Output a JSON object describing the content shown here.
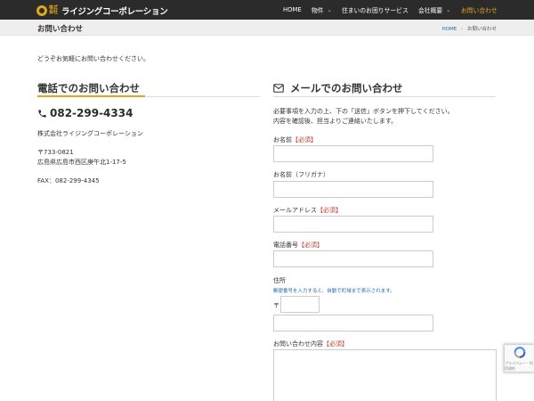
{
  "header": {
    "logo_small": "株式会社",
    "logo_text": "ライジングコーポレーション",
    "nav": [
      {
        "label": "HOME"
      },
      {
        "label": "物件"
      },
      {
        "label": "住まいのお困りサービス"
      },
      {
        "label": "会社概要"
      },
      {
        "label": "お問い合わせ"
      }
    ]
  },
  "titlebar": {
    "title": "お問い合わせ",
    "breadcrumb_home": "HOME",
    "breadcrumb_sep": "›",
    "breadcrumb_current": "お問い合わせ"
  },
  "intro": "どうぞお気軽にお問い合わせください。",
  "phone_section": {
    "heading": "電話でのお問い合わせ",
    "phone": "082-299-4334",
    "company": "株式会社ライジングコーポレーション",
    "postal": "〒733-0821",
    "address": "広島県広島市西区庚午北1-17-5",
    "fax": "FAX：082-299-4345"
  },
  "mail_section": {
    "heading": "メールでのお問い合わせ",
    "instruction1": "必要事項を入力の上、下の「送信」ボタンを押下してください。",
    "instruction2": "内容を確認後、担当よりご連絡いたします。",
    "required_mark": "【必須】",
    "label_name": "お名前",
    "label_kana": "お名前（フリガナ）",
    "label_email": "メールアドレス",
    "label_tel": "電話番号",
    "label_address": "住所",
    "address_hint": "郵便番号を入力すると、自動で町域まで表示されます。",
    "zip_mark": "〒",
    "label_message": "お問い合わせ内容"
  },
  "recaptcha": {
    "sub": "プライバシー・利用規約"
  },
  "colors": {
    "accent": "#e2a61a",
    "header_bg": "#2b2b2b",
    "required": "#c0392b",
    "link": "#2a6bb3"
  }
}
